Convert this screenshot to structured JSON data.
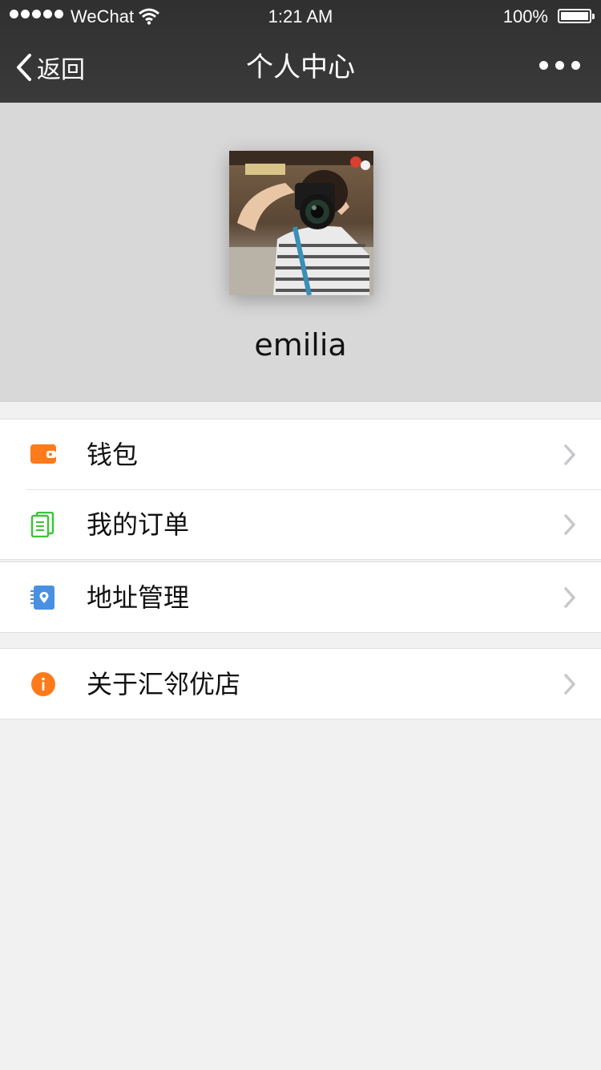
{
  "status_bar": {
    "carrier": "WeChat",
    "time": "1:21 AM",
    "battery": "100%",
    "battery_level": 1.0
  },
  "nav": {
    "back_label": "返回",
    "title": "个人中心",
    "more_icon": "more-icon"
  },
  "profile": {
    "username": "emilia"
  },
  "menu": {
    "wallet": {
      "label": "钱包",
      "icon": "wallet-icon",
      "color": "#ff7a1a"
    },
    "orders": {
      "label": "我的订单",
      "icon": "orders-icon",
      "color": "#3ec43a"
    },
    "address": {
      "label": "地址管理",
      "icon": "address-book-icon",
      "color": "#4a90e2"
    },
    "about": {
      "label": "关于汇邻优店",
      "icon": "info-icon",
      "color": "#ff7a1a"
    }
  }
}
